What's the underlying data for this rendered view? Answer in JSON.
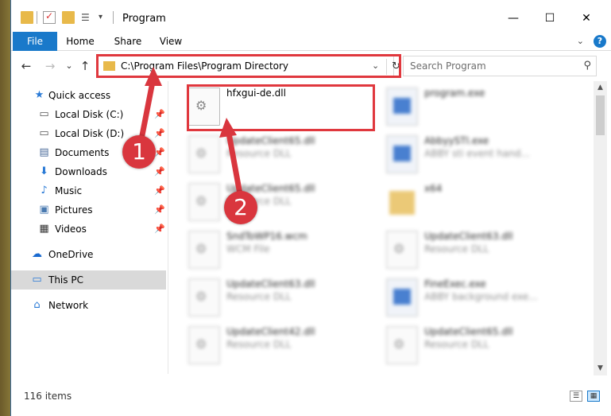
{
  "window": {
    "title": "Program"
  },
  "title_controls": {
    "minimize": "—",
    "maximize": "☐",
    "close": "✕"
  },
  "ribbon": {
    "tabs": [
      "File",
      "Home",
      "Share",
      "View"
    ]
  },
  "navigation": {
    "back": "←",
    "forward": "→",
    "recent": "⌄",
    "up": "↑"
  },
  "address": {
    "path": "C:\\Program Files\\Program Directory"
  },
  "search": {
    "placeholder": "Search Program"
  },
  "sidebar": {
    "items": [
      {
        "label": "Quick access",
        "icon": "star-icon"
      },
      {
        "label": "Local Disk (C:)",
        "icon": "drive-icon",
        "pinned": true
      },
      {
        "label": "Local Disk (D:)",
        "icon": "drive-icon",
        "pinned": true
      },
      {
        "label": "Documents",
        "icon": "documents-icon",
        "pinned": true
      },
      {
        "label": "Downloads",
        "icon": "download-icon",
        "pinned": true
      },
      {
        "label": "Music",
        "icon": "music-icon",
        "pinned": true
      },
      {
        "label": "Pictures",
        "icon": "pictures-icon",
        "pinned": true
      },
      {
        "label": "Videos",
        "icon": "videos-icon",
        "pinned": true
      },
      {
        "label": "OneDrive",
        "icon": "cloud-icon"
      },
      {
        "label": "This PC",
        "icon": "computer-icon",
        "selected": true
      },
      {
        "label": "Network",
        "icon": "network-icon"
      }
    ]
  },
  "files": [
    {
      "name": "hfxgui-de.dll",
      "type": "",
      "icon": "dll",
      "highlighted": true,
      "blurred": false
    },
    {
      "name": "program.exe",
      "type": "",
      "icon": "exe",
      "blurred": true
    },
    {
      "name": "UpdateClient65.dll",
      "type": "Resource DLL",
      "icon": "dll",
      "blurred": true
    },
    {
      "name": "AbbyySTI.exe",
      "type": "ABBY sti event hand...",
      "icon": "exe",
      "blurred": true
    },
    {
      "name": "UpdateClient65.dll",
      "type": "Resource DLL",
      "icon": "dll",
      "blurred": true
    },
    {
      "name": "x64",
      "type": "",
      "icon": "folder",
      "blurred": true
    },
    {
      "name": "SndToWP16.wcm",
      "type": "WCM File",
      "icon": "dll",
      "blurred": true
    },
    {
      "name": "UpdateClient63.dll",
      "type": "Resource DLL",
      "icon": "dll",
      "blurred": true
    },
    {
      "name": "UpdateClient63.dll",
      "type": "Resource DLL",
      "icon": "dll",
      "blurred": true
    },
    {
      "name": "FineExec.exe",
      "type": "ABBY background exe...",
      "icon": "exe",
      "blurred": true
    },
    {
      "name": "UpdateClient42.dll",
      "type": "Resource DLL",
      "icon": "dll",
      "blurred": true
    },
    {
      "name": "UpdateClient65.dll",
      "type": "Resource DLL",
      "icon": "dll",
      "blurred": true
    }
  ],
  "status": {
    "item_count": "116 items"
  },
  "annotations": {
    "step1": "1",
    "step2": "2",
    "color": "#d9363e"
  }
}
